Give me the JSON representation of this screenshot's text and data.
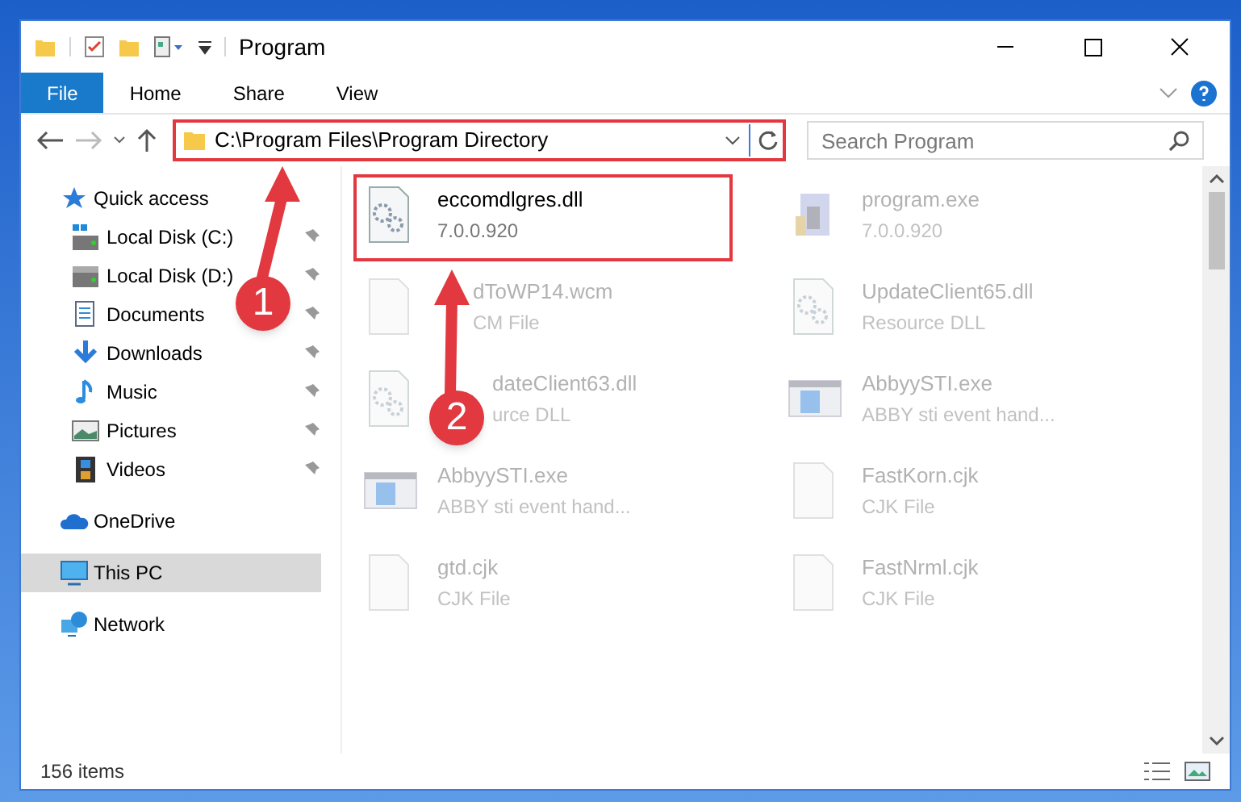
{
  "window": {
    "title": "Program"
  },
  "ribbon_tabs": [
    {
      "label": "File",
      "selected": true
    },
    {
      "label": "Home",
      "selected": false
    },
    {
      "label": "Share",
      "selected": false
    },
    {
      "label": "View",
      "selected": false
    }
  ],
  "address_bar": {
    "path": "C:\\Program Files\\Program Directory",
    "highlighted": true
  },
  "search": {
    "placeholder": "Search Program"
  },
  "sidebar": {
    "items": [
      {
        "label": "Quick access",
        "kind": "star",
        "pinned": false,
        "selected": false,
        "children": [
          {
            "label": "Local Disk (C:)",
            "kind": "disk-c",
            "pinned": true,
            "selected": false
          },
          {
            "label": "Local Disk (D:)",
            "kind": "disk",
            "pinned": true,
            "selected": false
          },
          {
            "label": "Documents",
            "kind": "documents",
            "pinned": true,
            "selected": false
          },
          {
            "label": "Downloads",
            "kind": "downloads",
            "pinned": true,
            "selected": false
          },
          {
            "label": "Music",
            "kind": "music",
            "pinned": true,
            "selected": false
          },
          {
            "label": "Pictures",
            "kind": "pictures",
            "pinned": true,
            "selected": false
          },
          {
            "label": "Videos",
            "kind": "videos",
            "pinned": true,
            "selected": false
          }
        ]
      },
      {
        "label": "OneDrive",
        "kind": "cloud",
        "pinned": false,
        "selected": false
      },
      {
        "label": "This PC",
        "kind": "pc",
        "pinned": false,
        "selected": true
      },
      {
        "label": "Network",
        "kind": "network",
        "pinned": false,
        "selected": false
      }
    ]
  },
  "files": [
    {
      "name": "eccomdlgres.dll",
      "detail": "7.0.0.920",
      "kind": "gears",
      "highlighted": true,
      "blurred": false
    },
    {
      "name": "program.exe",
      "detail": "7.0.0.920",
      "kind": "program",
      "highlighted": false,
      "blurred": true
    },
    {
      "name": "dToWP14.wcm",
      "detail": "CM File",
      "kind": "blank",
      "highlighted": false,
      "blurred": true
    },
    {
      "name": "UpdateClient65.dll",
      "detail": "Resource DLL",
      "kind": "gears",
      "highlighted": false,
      "blurred": true
    },
    {
      "name": "dateClient63.dll",
      "detail": "urce DLL",
      "kind": "gears",
      "highlighted": false,
      "blurred": true
    },
    {
      "name": "AbbyySTI.exe",
      "detail": "ABBY sti event hand...",
      "kind": "window",
      "highlighted": false,
      "blurred": true
    },
    {
      "name": "AbbyySTI.exe",
      "detail": "ABBY sti event hand...",
      "kind": "window",
      "highlighted": false,
      "blurred": true
    },
    {
      "name": "FastKorn.cjk",
      "detail": "CJK File",
      "kind": "blank",
      "highlighted": false,
      "blurred": true
    },
    {
      "name": "gtd.cjk",
      "detail": "CJK File",
      "kind": "blank",
      "highlighted": false,
      "blurred": true
    },
    {
      "name": "FastNrml.cjk",
      "detail": "CJK File",
      "kind": "blank",
      "highlighted": false,
      "blurred": true
    }
  ],
  "annotations": [
    {
      "number": "1"
    },
    {
      "number": "2"
    }
  ],
  "status_bar": {
    "item_count": "156 items"
  }
}
